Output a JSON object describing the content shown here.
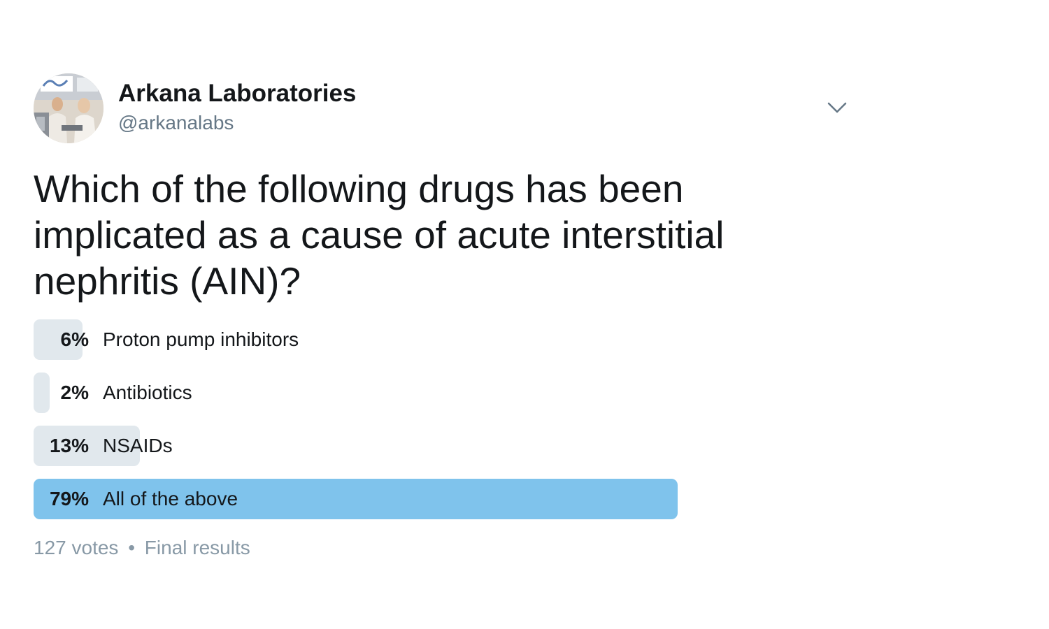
{
  "tweet": {
    "author": {
      "display_name": "Arkana Laboratories",
      "handle": "@arkanalabs",
      "avatar_icon": "lab-photo-avatar"
    },
    "menu_icon": "chevron-down-icon",
    "question": "Which of the following drugs has been implicated as a cause of acute interstitial nephritis (AIN)?"
  },
  "poll": {
    "options": [
      {
        "percent": 6,
        "percent_label": "6%",
        "label": "Proton pump inhibitors",
        "winner": false
      },
      {
        "percent": 2,
        "percent_label": "2%",
        "label": "Antibiotics",
        "winner": false
      },
      {
        "percent": 13,
        "percent_label": "13%",
        "label": "NSAIDs",
        "winner": false
      },
      {
        "percent": 79,
        "percent_label": "79%",
        "label": "All of the above",
        "winner": true
      }
    ],
    "votes": "127 votes",
    "separator": "•",
    "status": "Final results"
  },
  "colors": {
    "bar": "#e1e8ed",
    "winner_bar": "#7fc3ec",
    "muted_text": "#8899a6",
    "handle_text": "#657786"
  }
}
